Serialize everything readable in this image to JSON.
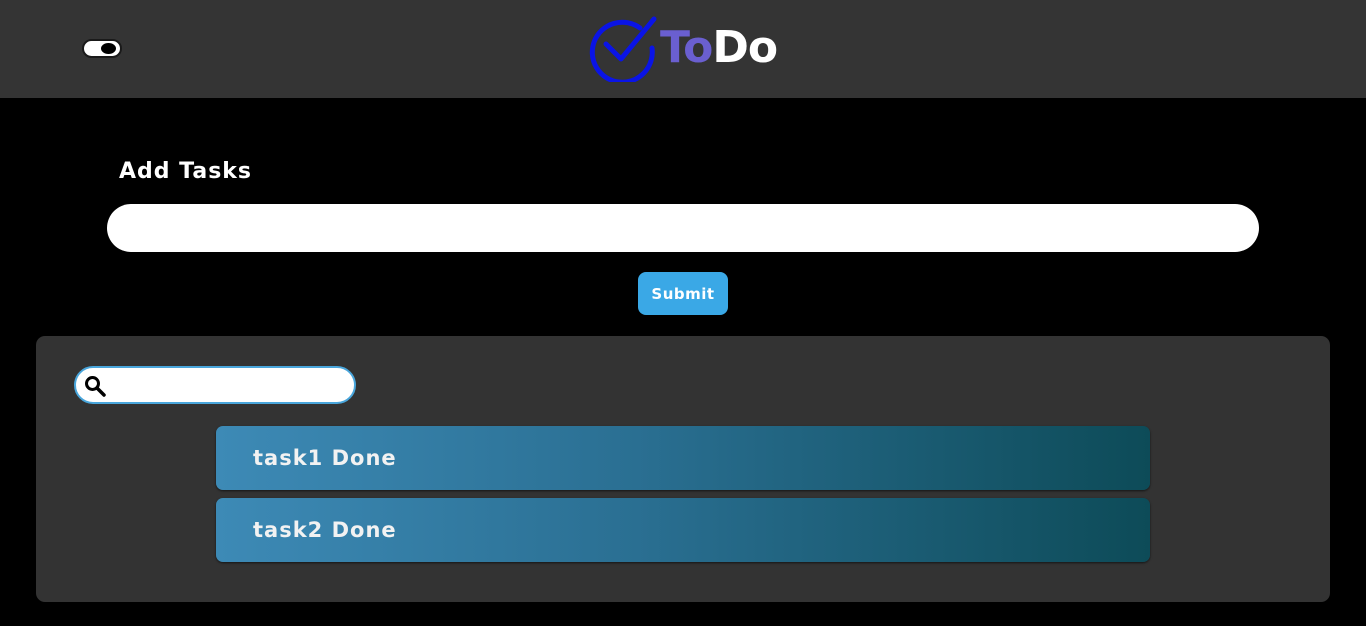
{
  "header": {
    "logo_to": "To",
    "logo_do": "Do",
    "logo_icon": "check-circle-icon",
    "theme_toggle_icon": "eye-toggle-icon"
  },
  "add_section": {
    "label": "Add Tasks",
    "input_value": "",
    "input_placeholder": "",
    "submit_label": "Submit"
  },
  "search": {
    "icon": "search-icon",
    "value": "",
    "placeholder": ""
  },
  "tasks": [
    {
      "label": "task1 Done"
    },
    {
      "label": "task2 Done"
    }
  ],
  "colors": {
    "header_bg": "#343434",
    "page_bg": "#000000",
    "panel_bg": "#333333",
    "accent_blue": "#3aa8e6",
    "logo_check": "#0a14e6",
    "logo_to": "#6a5fd0",
    "task_gradient_start": "#3d8ab6",
    "task_gradient_end": "#0d4b58"
  }
}
